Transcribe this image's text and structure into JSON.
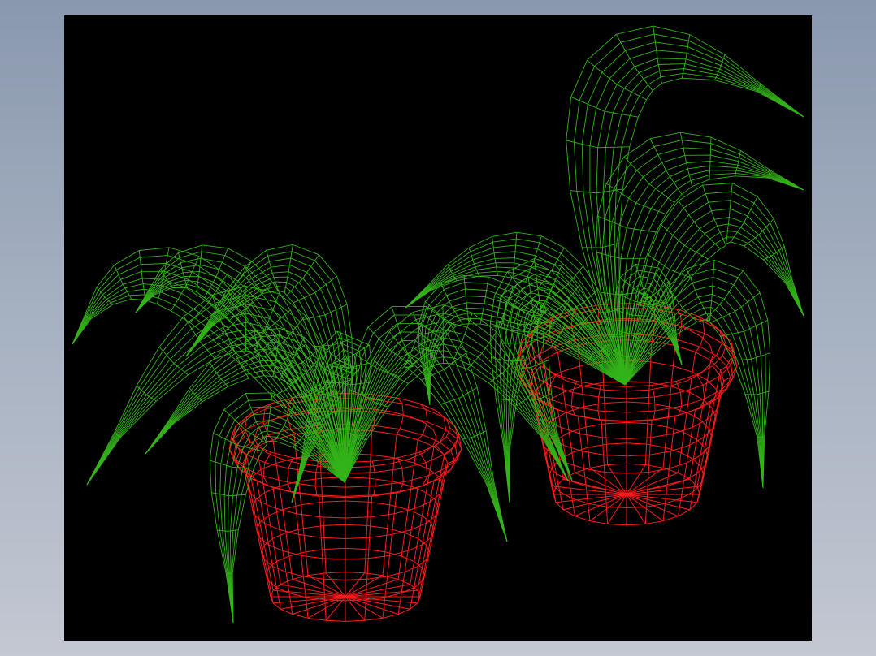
{
  "viewport": {
    "background": "#000000"
  },
  "scene": {
    "objects": [
      {
        "name": "left-plant-pot",
        "kind": "pot",
        "color": "#ff1a1a"
      },
      {
        "name": "right-plant-pot",
        "kind": "pot",
        "color": "#ff1a1a"
      },
      {
        "name": "left-plant-leaves",
        "kind": "leaves",
        "color": "#33b319"
      },
      {
        "name": "right-plant-leaves",
        "kind": "leaves",
        "color": "#33b319"
      }
    ],
    "render_style": "wireframe"
  }
}
